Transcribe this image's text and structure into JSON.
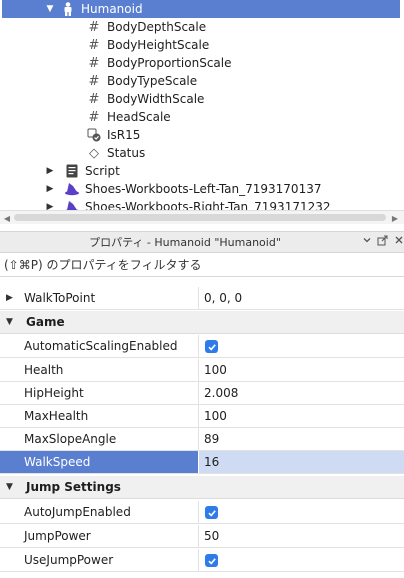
{
  "explorer": {
    "items": [
      {
        "label": "Humanoid",
        "icon": "humanoid-icon",
        "arrow": "▼",
        "selected": true
      },
      {
        "label": "BodyDepthScale",
        "icon": "number-value-icon",
        "glyph": "#"
      },
      {
        "label": "BodyHeightScale",
        "icon": "number-value-icon",
        "glyph": "#"
      },
      {
        "label": "BodyProportionScale",
        "icon": "number-value-icon",
        "glyph": "#"
      },
      {
        "label": "BodyTypeScale",
        "icon": "number-value-icon",
        "glyph": "#"
      },
      {
        "label": "BodyWidthScale",
        "icon": "number-value-icon",
        "glyph": "#"
      },
      {
        "label": "HeadScale",
        "icon": "number-value-icon",
        "glyph": "#"
      },
      {
        "label": "IsR15",
        "icon": "bool-value-icon"
      },
      {
        "label": "Status",
        "icon": "status-icon",
        "glyph": "◇"
      },
      {
        "label": "Script",
        "icon": "script-icon",
        "arrow": "▶"
      },
      {
        "label": "Shoes-Workboots-Left-Tan_7193170137",
        "icon": "accessory-icon",
        "arrow": "▶"
      },
      {
        "label": "Shoes-Workboots-Right-Tan_7193171232",
        "icon": "accessory-icon",
        "arrow": "▶"
      }
    ]
  },
  "properties": {
    "title": "プロパティ - Humanoid \"Humanoid\"",
    "filter_placeholder": "(⇧⌘P) のプロパティをフィルタする",
    "walk_to_point": {
      "name": "WalkToPoint",
      "value": "0, 0, 0"
    },
    "categories": [
      {
        "label": "Game",
        "rows": [
          {
            "name": "AutomaticScalingEnabled",
            "type": "bool",
            "value": true
          },
          {
            "name": "Health",
            "value": "100"
          },
          {
            "name": "HipHeight",
            "value": "2.008"
          },
          {
            "name": "MaxHealth",
            "value": "100"
          },
          {
            "name": "MaxSlopeAngle",
            "value": "89"
          },
          {
            "name": "WalkSpeed",
            "value": "16",
            "selected": true
          }
        ]
      },
      {
        "label": "Jump Settings",
        "rows": [
          {
            "name": "AutoJumpEnabled",
            "type": "bool",
            "value": true
          },
          {
            "name": "JumpPower",
            "value": "50"
          },
          {
            "name": "UseJumpPower",
            "type": "bool",
            "value": true
          }
        ]
      }
    ]
  },
  "colors": {
    "selection": "#5a7fd0",
    "selection_value": "#cfdbf3",
    "checkbox": "#2f7bea",
    "accessory_icon": "#5a3fc8"
  }
}
